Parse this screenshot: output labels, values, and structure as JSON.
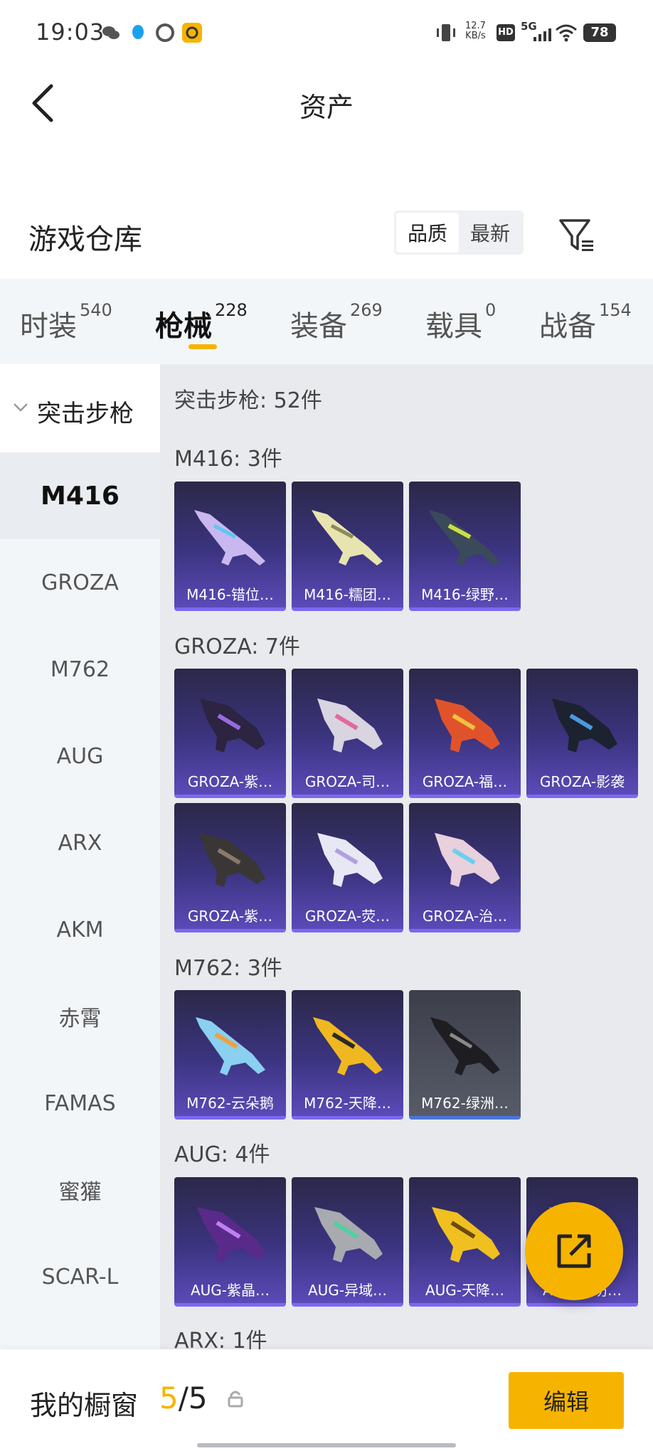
{
  "status_bar": {
    "time": "19:03",
    "net_speed_value": "12.7",
    "net_speed_unit": "KB/s",
    "hd": "HD",
    "signal": "5G",
    "battery": "78"
  },
  "nav": {
    "title": "资产"
  },
  "warehouse": {
    "title": "游戏仓库",
    "sort_options": [
      "品质",
      "最新"
    ],
    "active_sort": "品质"
  },
  "tabs": [
    {
      "label": "时装",
      "count": "540"
    },
    {
      "label": "枪械",
      "count": "228"
    },
    {
      "label": "装备",
      "count": "269"
    },
    {
      "label": "载具",
      "count": "0"
    },
    {
      "label": "战备",
      "count": "154"
    }
  ],
  "active_tab": "枪械",
  "sidebar": {
    "group": "突击步枪",
    "items": [
      "M416",
      "GROZA",
      "M762",
      "AUG",
      "ARX",
      "AKM",
      "赤霄",
      "FAMAS",
      "蜜獾",
      "SCAR-L"
    ],
    "active": "M416"
  },
  "content": {
    "title": "突击步枪: 52件",
    "sections": [
      {
        "title": "M416: 3件",
        "items": [
          "M416-错位…",
          "M416-糯团…",
          "M416-绿野…"
        ]
      },
      {
        "title": "GROZA: 7件",
        "items": [
          "GROZA-紫…",
          "GROZA-司…",
          "GROZA-福…",
          "GROZA-影袭",
          "GROZA-紫…",
          "GROZA-荧…",
          "GROZA-治…"
        ]
      },
      {
        "title": "M762: 3件",
        "items": [
          "M762-云朵鹅",
          "M762-天降…",
          "M762-绿洲…"
        ]
      },
      {
        "title": "AUG: 4件",
        "items": [
          "AUG-紫晶…",
          "AUG-异域…",
          "AUG-天降…",
          "AUG-游坊…"
        ]
      },
      {
        "title": "ARX: 1件",
        "items": []
      }
    ]
  },
  "bottom": {
    "showcase_label": "我的橱窗",
    "showcase_current": "5",
    "showcase_separator": "/",
    "showcase_total": "5",
    "edit_label": "编辑"
  },
  "colors": {
    "accent": "#f6b400",
    "card_purple": "#3b3480",
    "card_grey": "#575b68"
  }
}
